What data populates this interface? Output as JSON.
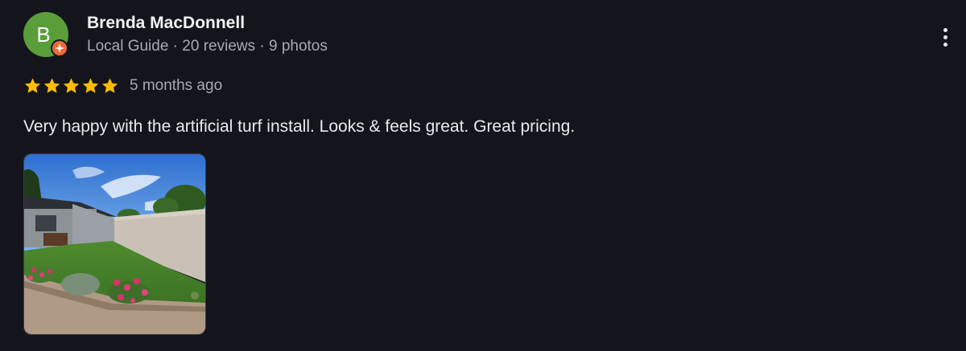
{
  "reviewer": {
    "avatar_letter": "B",
    "avatar_color": "#5a9e3a",
    "badge_icon": "local-guide-star-icon",
    "badge_color": "#ea6b3b",
    "name": "Brenda MacDonnell",
    "meta": "Local Guide · 20 reviews · 9 photos"
  },
  "rating": {
    "stars": 5,
    "max_stars": 5,
    "star_color": "#fbbc04",
    "time_ago": "5 months ago"
  },
  "review": {
    "text": "Very happy with the artificial turf install. Looks & feels great. Great pricing."
  },
  "photos": [
    {
      "subject": "backyard artificial turf with flowers"
    }
  ],
  "menu": {
    "icon": "more-vertical-icon"
  }
}
